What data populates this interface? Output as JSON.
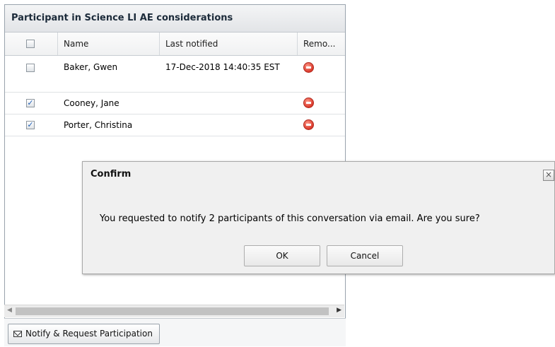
{
  "panel": {
    "title": "Participant in Science LI AE considerations",
    "columns": {
      "name": "Name",
      "last_notified": "Last notified",
      "remove": "Remo..."
    },
    "rows": [
      {
        "checked": false,
        "name": "Baker, Gwen",
        "last_notified": "17-Dec-2018 14:40:35 EST",
        "remove_icon": "remove-circle-icon"
      },
      {
        "checked": true,
        "name": "Cooney, Jane",
        "last_notified": "",
        "remove_icon": "remove-circle-icon"
      },
      {
        "checked": true,
        "name": "Porter, Christina",
        "last_notified": "",
        "remove_icon": "remove-circle-icon"
      }
    ],
    "footer_button": "Notify & Request Participation"
  },
  "dialog": {
    "title": "Confirm",
    "message": "You requested to notify 2 participants of this conversation via email. Are you sure?",
    "ok_label": "OK",
    "cancel_label": "Cancel"
  },
  "colors": {
    "remove_icon": "#d9382a",
    "checkmark": "#1f5fb5"
  }
}
